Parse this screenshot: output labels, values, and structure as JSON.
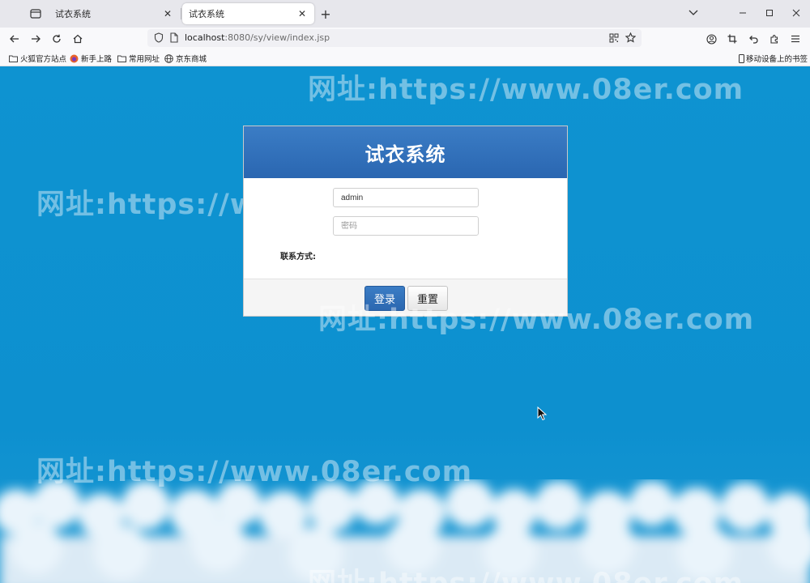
{
  "browser": {
    "tabs": [
      {
        "label": "试衣系统"
      },
      {
        "label": "试衣系统"
      }
    ],
    "url": {
      "host": "localhost",
      "path": ":8080/sy/view/index.jsp"
    },
    "bookmarks": [
      {
        "label": "火狐官方站点",
        "icon": "folder-icon"
      },
      {
        "label": "新手上路",
        "icon": "firefox-icon"
      },
      {
        "label": "常用网址",
        "icon": "folder-icon"
      },
      {
        "label": "京东商城",
        "icon": "globe-icon"
      }
    ],
    "mobile_bookmarks": "移动设备上的书签"
  },
  "page": {
    "watermark": "网址:https://www.08er.com",
    "login": {
      "title": "试衣系统",
      "username_value": "admin",
      "password_placeholder": "密码",
      "contact_label": "联系方式:",
      "login_button": "登录",
      "reset_button": "重置"
    }
  },
  "colors": {
    "page_background": "#0f91cf",
    "header_blue": "#2e6db6",
    "watermark": "rgba(255,255,255,0.42)"
  }
}
